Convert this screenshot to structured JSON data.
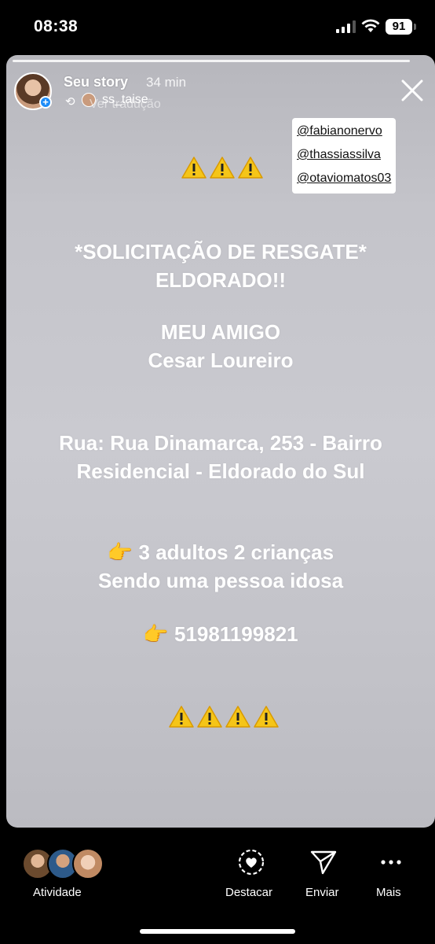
{
  "status_bar": {
    "time": "08:38",
    "battery": "91"
  },
  "story": {
    "user": "Seu story",
    "time": "34 min",
    "repost_user": "ss_taise",
    "translation": "Ver tradução",
    "mentions": [
      "@fabianonervo",
      "@thassiassilva",
      "@otaviomatos03"
    ],
    "lines": {
      "title1": "*SOLICITAÇÃO DE RESGATE*",
      "title2": "ELDORADO!!",
      "friend_label": "MEU AMIGO",
      "friend_name": "Cesar Loureiro",
      "address1": "Rua: Rua Dinamarca, 253 - Bairro",
      "address2": "Residencial - Eldorado do Sul",
      "people1": "3 adultos 2 crianças",
      "people2": "Sendo uma pessoa idosa",
      "phone": "51981199821"
    },
    "icons": {
      "warning": "warning-sign-icon",
      "pointing": "pointing-hand-icon"
    }
  },
  "bottom_bar": {
    "activity_label": "Atividade",
    "highlight_label": "Destacar",
    "send_label": "Enviar",
    "more_label": "Mais"
  },
  "colors": {
    "accent": "#1d8cf8",
    "warning": "#f5c518"
  }
}
